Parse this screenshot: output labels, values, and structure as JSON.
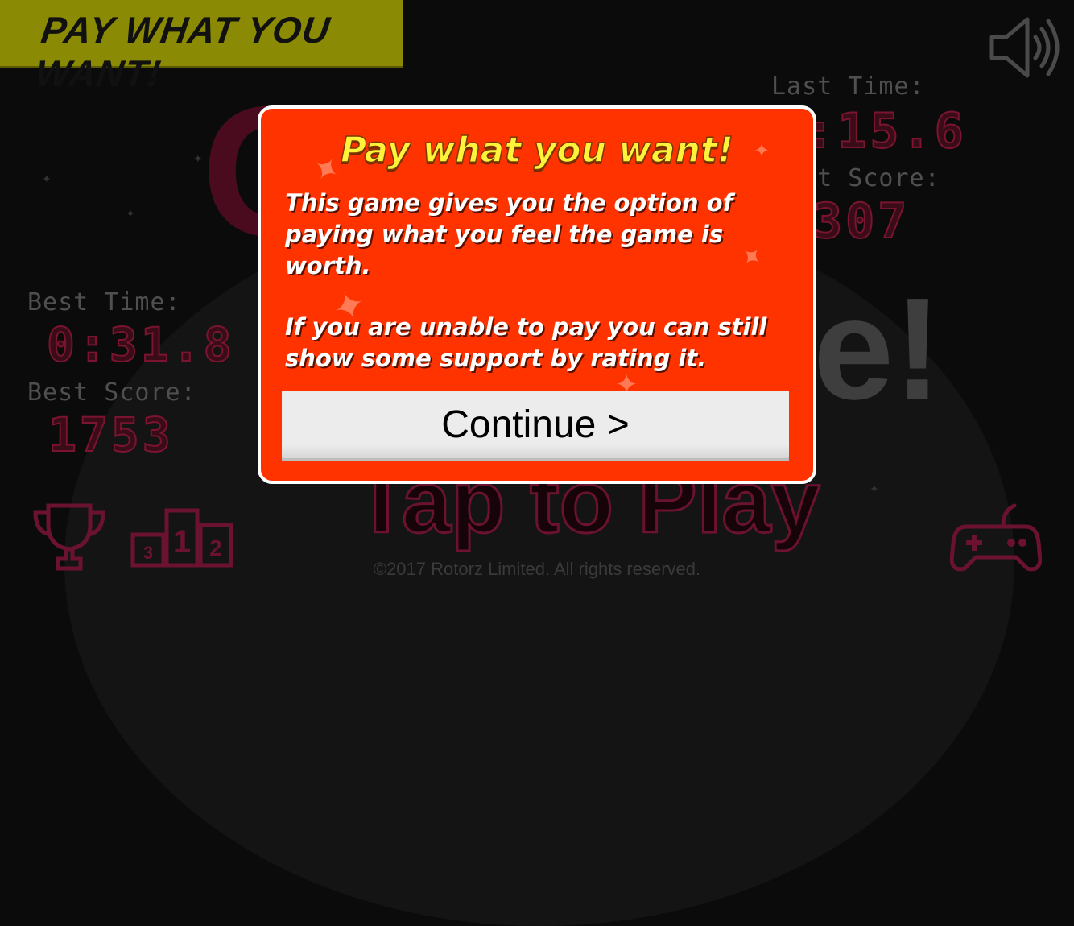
{
  "banner": {
    "label": "PAY WHAT YOU WANT!"
  },
  "background": {
    "big_letters": "Co",
    "exclamation": "e!",
    "tap_to_play": "Tap to Play",
    "copyright": "©2017 Rotorz Limited. All rights reserved."
  },
  "stats_right": {
    "last_time_label": "Last Time:",
    "last_time_value": "0:15.6",
    "last_score_label": "Best Score:",
    "last_score_value": "307"
  },
  "stats_left": {
    "best_time_label": "Best Time:",
    "best_time_value": "0:31.8",
    "best_score_label": "Best Score:",
    "best_score_value": "1753"
  },
  "icons": {
    "speaker": "speaker-icon",
    "trophy": "trophy-icon",
    "leaderboard": "leaderboard-icon",
    "gamepad": "gamepad-icon"
  },
  "modal": {
    "title": "Pay what you want!",
    "paragraph1": "This game gives you the option of paying what you feel the game is worth.",
    "paragraph2": "If you are unable to pay you can still show some support by rating it.",
    "continue_label": "Continue >"
  },
  "colors": {
    "modal_background": "#ff3300",
    "title_yellow": "#fff23a",
    "banner": "#8b8a04"
  }
}
